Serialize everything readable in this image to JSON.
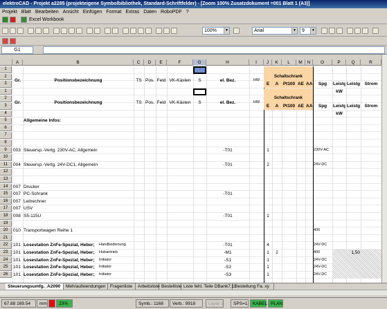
{
  "title": "elektroCAD - Projekt a2285  (projekteigene Symbolbibliothek, Standard-Schriftfelder) - [Zoom 100% Zusatzdokument =001 Blatt 1 (A3)]",
  "menu": [
    "Projekt",
    "Blatt",
    "Bearbeiten",
    "Ansicht",
    "Einfügen",
    "Format",
    "Extras",
    "Daten",
    "RoboPDF",
    "?"
  ],
  "toolbar1": {
    "workbook_label": "Excel Workbook"
  },
  "toolbar2": {
    "zoom": "100%",
    "font": "Arial",
    "size": "9"
  },
  "namebox": "G1",
  "columns": [
    "A",
    "B",
    "C",
    "D",
    "E",
    "F",
    "G",
    "H",
    "I",
    "J",
    "K",
    "L",
    "M",
    "N",
    "O",
    "P",
    "Q",
    "R"
  ],
  "header_top": {
    "schaltschrank": "Schaltschrank",
    "gr": "Gr.",
    "pos_bez": "Positionsbezeichnung",
    "ts": "TS",
    "pos": "Pos.",
    "feld": "Feld",
    "vk": "VK-Kästen",
    "s": "S",
    "el_bez": "el. Bez.",
    "hw": "HW",
    "e": "E",
    "a": "A",
    "pt100": "Pt100",
    "ae": "AE",
    "aa": "AA",
    "spg": "Spg",
    "leistg1": "Leistg",
    "leistg2": "Leistg",
    "strom": "Strom",
    "kw": "kW"
  },
  "rows": [
    {
      "n": "5",
      "b": "Allgemeine Infos:",
      "bold": true
    },
    {
      "n": "9",
      "a": "003",
      "b": "Steuersp.-Vertg. 230V-AC, Allgemein",
      "h": "-T01",
      "j": "1",
      "o": "230V-AC"
    },
    {
      "n": "11",
      "a": "004",
      "b": "Steuersp.-Vertg. 24V-DC1, Allgemein",
      "h": "-T01",
      "j": "2",
      "o": "24V-DC"
    },
    {
      "n": "14",
      "a": "007",
      "b": "Drucker"
    },
    {
      "n": "15",
      "a": "007",
      "b": "PC-Schrank",
      "h": "-T01"
    },
    {
      "n": "16",
      "a": "007",
      "b": "Leitrechner"
    },
    {
      "n": "17",
      "a": "007",
      "b": "USV"
    },
    {
      "n": "18",
      "a": "008",
      "b": "S5-115U",
      "h": "-T01",
      "j": "1"
    },
    {
      "n": "20",
      "a": "010",
      "b": "Transportwagen Reihe 1",
      "o": "400"
    },
    {
      "n": "22",
      "a": "101",
      "b": "Losestation ZnFe-Spezial, Heber;",
      "bsub": "Handbedienung",
      "h": "-T01",
      "j": "4",
      "o": "24V-DC"
    },
    {
      "n": "23",
      "a": "101",
      "b": "Losestation ZnFe-Spezial, Heber;",
      "bsub": "Hubantrieb",
      "h": "-M1",
      "j": "1",
      "k": "2",
      "o": "400",
      "q": "1,50"
    },
    {
      "n": "24",
      "a": "101",
      "b": "Losestation ZnFe-Spezial, Heber;",
      "bsub": "Initiator",
      "h": "-S1",
      "j": "1",
      "o": "24V-DC"
    },
    {
      "n": "25",
      "a": "101",
      "b": "Losestation ZnFe-Spezial, Heber;",
      "bsub": "Initiator",
      "h": "-S2",
      "j": "1",
      "o": "24V-DC"
    },
    {
      "n": "26",
      "a": "101",
      "b": "Losestation ZnFe-Spezial, Heber;",
      "bsub": "Initiator",
      "h": "-S3",
      "j": "1",
      "o": "24V-DC"
    }
  ],
  "tabs": [
    "Steuerungsumfg._A2090",
    "Mehraufwendungen",
    "Fragenliste",
    "Arbeitsliste",
    "Bestelliste",
    "Liste fehl. Teile DBank7.11",
    "Bestellung Fa. xy"
  ],
  "status": {
    "coords": "67.88  169.54",
    "unit": "mm",
    "pct": "23%",
    "symb": "Symb.: 1168",
    "verb": "Verb.: 9918",
    "layer": "Layer 1",
    "sps": "SPS=1",
    "kabel": "KABEL",
    "plan": "PLAN"
  }
}
